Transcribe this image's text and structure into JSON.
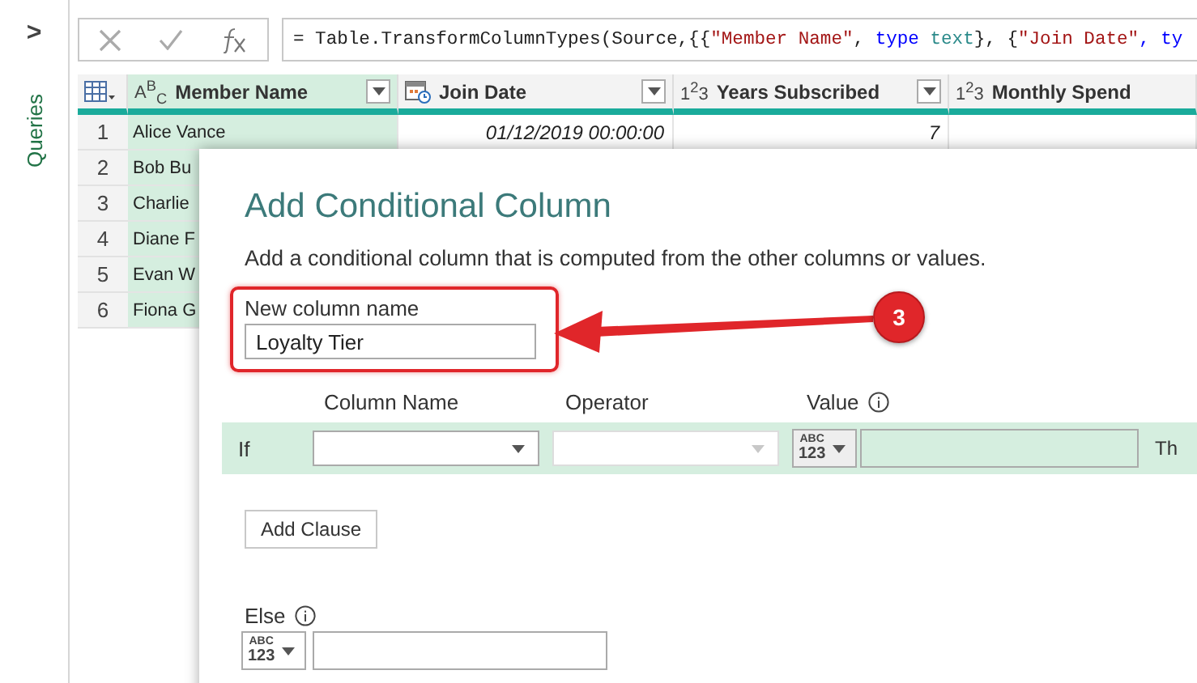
{
  "sidebar": {
    "expand_glyph": ">",
    "title": "Queries"
  },
  "formula_bar": {
    "segments": [
      {
        "text": "= Table.TransformColumnTypes(Source,{{",
        "kind": "plain"
      },
      {
        "text": "\"Member Name\"",
        "kind": "string"
      },
      {
        "text": ", ",
        "kind": "plain"
      },
      {
        "text": "type",
        "kind": "keyword"
      },
      {
        "text": " text",
        "kind": "type"
      },
      {
        "text": "}, {",
        "kind": "plain"
      },
      {
        "text": "\"Join Date\"",
        "kind": "string"
      },
      {
        "text": ", ty",
        "kind": "keyword"
      }
    ]
  },
  "table": {
    "columns": [
      {
        "name": "Member Name",
        "type_label": "A$^{B}$$_{C}$",
        "selected": true
      },
      {
        "name": "Join Date",
        "selected": false
      },
      {
        "name": "Years Subscribed",
        "type_label": "1$^{2}$3",
        "selected": false
      },
      {
        "name": "Monthly Spend",
        "type_label": "1$^{2}$3",
        "selected": false
      }
    ],
    "rows": [
      {
        "index": "1",
        "cells": [
          "Alice Vance",
          "01/12/2019 00:00:00",
          "7"
        ]
      },
      {
        "index": "2",
        "cells": [
          "Bob Bu"
        ]
      },
      {
        "index": "3",
        "cells": [
          "Charlie"
        ]
      },
      {
        "index": "4",
        "cells": [
          "Diane F"
        ]
      },
      {
        "index": "5",
        "cells": [
          "Evan W"
        ]
      },
      {
        "index": "6",
        "cells": [
          "Fiona G"
        ]
      }
    ]
  },
  "dialog": {
    "title": "Add Conditional Column",
    "description": "Add a conditional column that is computed from the other columns or values.",
    "new_column": {
      "label": "New column name",
      "value": "Loyalty Tier",
      "highlighted": true
    },
    "clause_headers": [
      "Column Name",
      "Operator",
      "Value"
    ],
    "if_row": {
      "label": "If",
      "column_dropdown": {
        "disabled": false
      },
      "operator_dropdown": {
        "disabled": true
      },
      "value_type": [
        "ABC",
        "123"
      ],
      "then_label": "Th"
    },
    "add_clause": "Add Clause",
    "else": {
      "label": "Else",
      "value_type": [
        "ABC",
        "123"
      ]
    }
  },
  "annotation": {
    "step": "3"
  }
}
